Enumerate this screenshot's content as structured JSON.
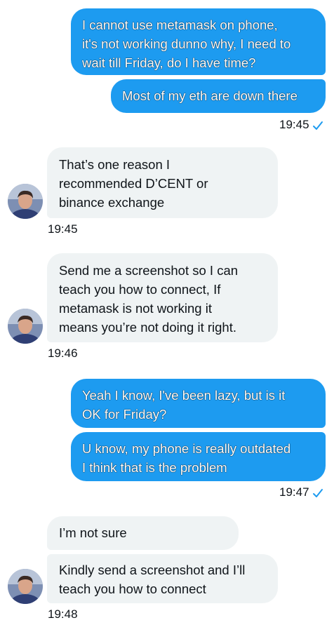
{
  "colors": {
    "outgoing_bubble": "#1d9bf0",
    "incoming_bubble": "#eff3f4",
    "check": "#1d9bf0"
  },
  "messages": [
    {
      "direction": "out",
      "lines": [
        "I cannot use metamask on phone,",
        "it's not working dunno why, I need to",
        "wait till Friday, do I have time?"
      ]
    },
    {
      "direction": "out",
      "lines": [
        "Most of my eth are down there"
      ]
    },
    {
      "direction": "in",
      "lines": [
        "That’s one reason I",
        "recommended D’CENT or",
        "binance exchange"
      ]
    },
    {
      "direction": "in",
      "lines": [
        "Send me a screenshot so I can",
        "teach you how to connect, If",
        "metamask is not working it",
        "means you’re not doing it right."
      ]
    },
    {
      "direction": "out",
      "lines": [
        "Yeah I know, I've been lazy, but is it",
        "OK for Friday?"
      ]
    },
    {
      "direction": "out",
      "lines": [
        "U know, my phone is really outdated",
        "I think that is the problem"
      ]
    },
    {
      "direction": "in",
      "lines": [
        "I’m not sure"
      ]
    },
    {
      "direction": "in",
      "lines": [
        "Kindly send a screenshot and I’ll",
        "teach you how to connect"
      ]
    }
  ],
  "timestamps": [
    "19:45",
    "19:45",
    "19:46",
    "19:47",
    "19:48"
  ],
  "icons": {
    "read_receipt": "check-icon",
    "avatar": "avatar"
  }
}
